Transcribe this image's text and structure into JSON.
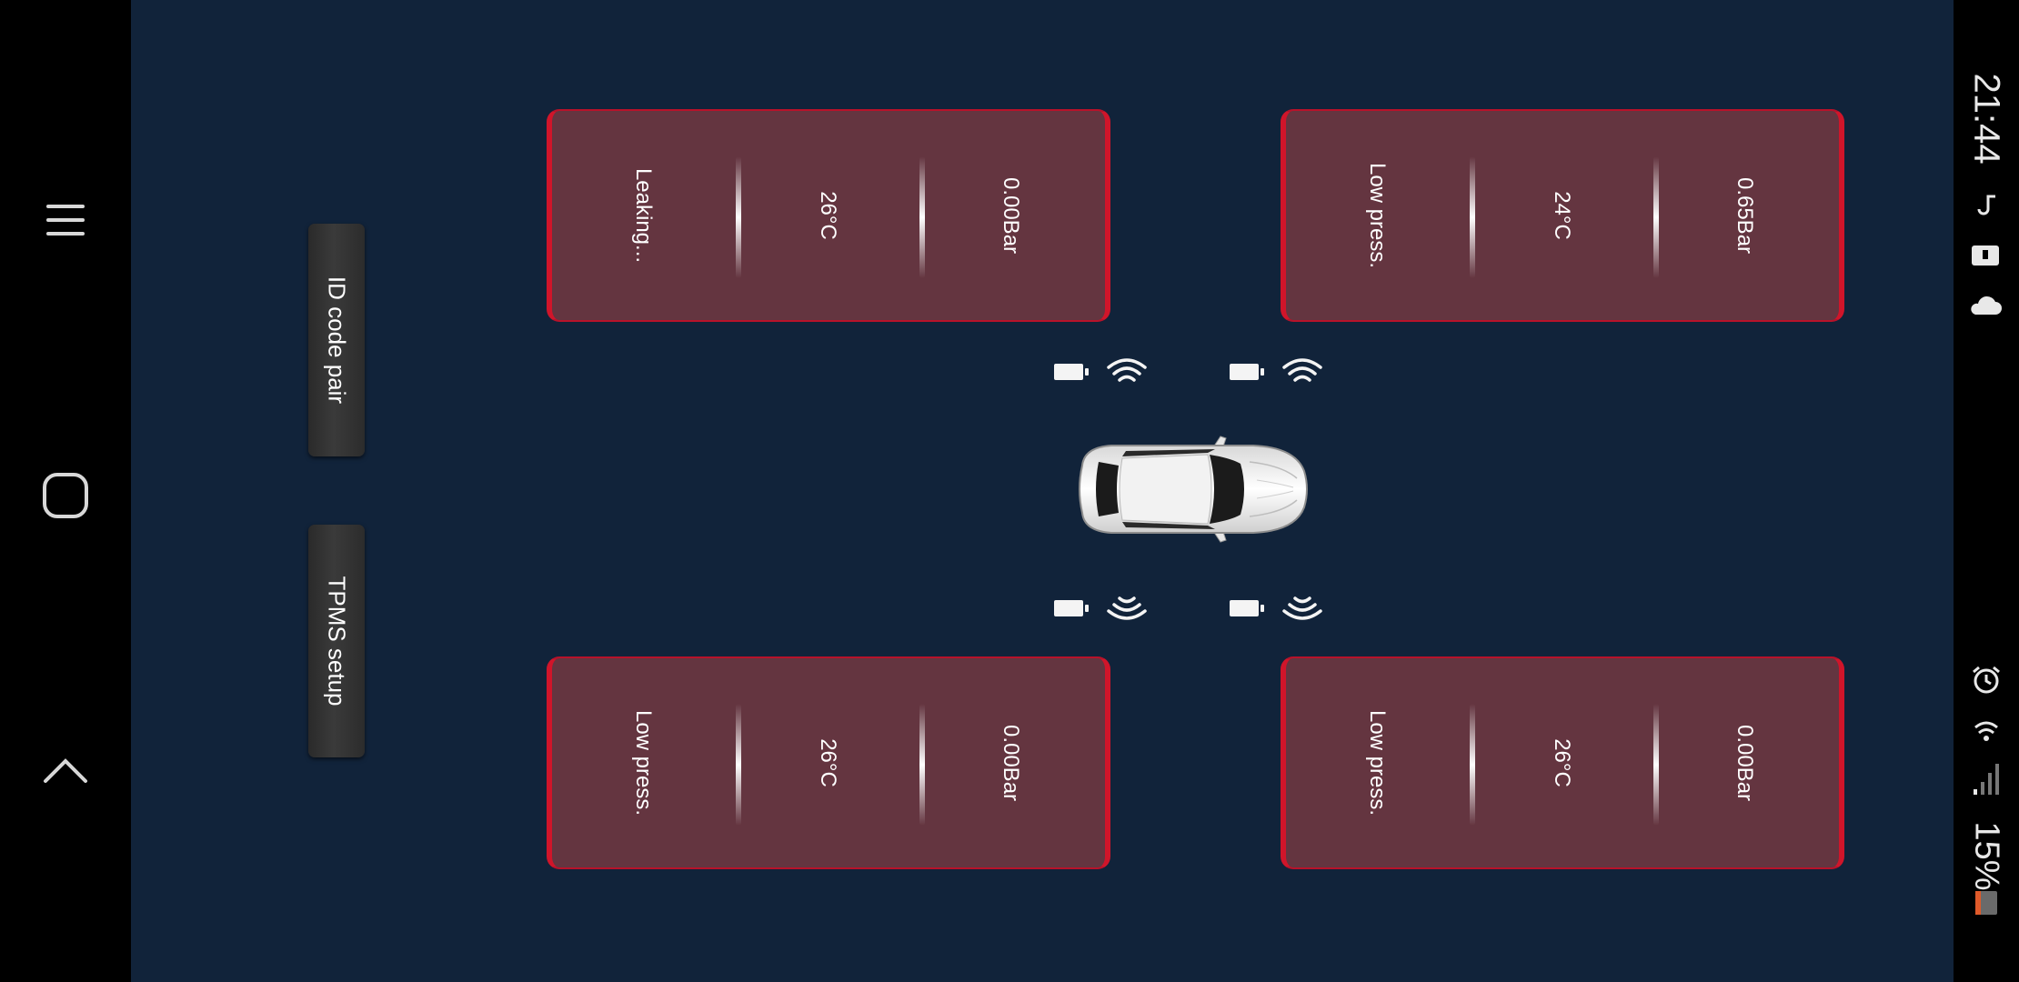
{
  "status_bar": {
    "time": "21:44",
    "battery_percent": "15%"
  },
  "nav_bar": {
    "menu_icon": "hamburger-menu-icon",
    "home_icon": "home-icon",
    "back_icon": "chevron-up-icon"
  },
  "actions": {
    "id_pair_label": "ID code pair",
    "setup_label": "TPMS setup"
  },
  "tires": {
    "front_left": {
      "status": "Leaking...",
      "temperature": "26°C",
      "pressure": "0.00Bar"
    },
    "front_right": {
      "status": "Low press.",
      "temperature": "24°C",
      "pressure": "0.65Bar"
    },
    "rear_left": {
      "status": "Low press.",
      "temperature": "26°C",
      "pressure": "0.00Bar"
    },
    "rear_right": {
      "status": "Low press.",
      "temperature": "26°C",
      "pressure": "0.00Bar"
    }
  },
  "colors": {
    "background": "#11233a",
    "card_fill": "#643540",
    "card_border": "#d0152a"
  }
}
